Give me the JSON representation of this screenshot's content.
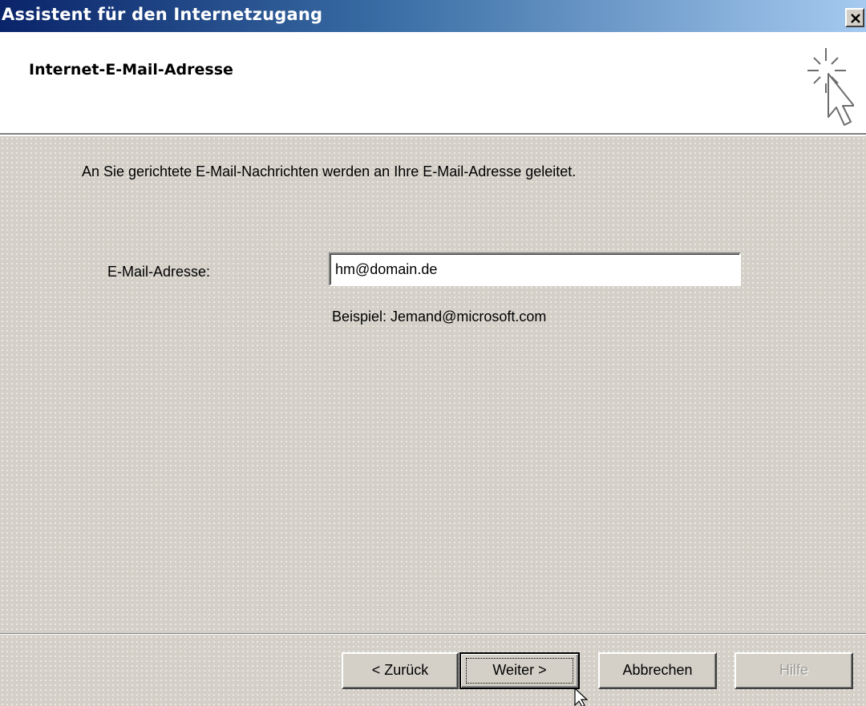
{
  "window": {
    "title": "Assistent für den Internetzugang",
    "close_icon": "close-icon"
  },
  "header": {
    "title": "Internet-E-Mail-Adresse",
    "icon": "wizard-sparkle-cursor-icon"
  },
  "body": {
    "intro_text": "An Sie gerichtete E-Mail-Nachrichten werden an Ihre E-Mail-Adresse geleitet.",
    "email_label": "E-Mail-Adresse:",
    "email_value": "hm@domain.de",
    "example_text": "Beispiel: Jemand@microsoft.com"
  },
  "buttons": {
    "back": "< Zurück",
    "next": "Weiter >",
    "cancel": "Abbrechen",
    "help": "Hilfe"
  }
}
